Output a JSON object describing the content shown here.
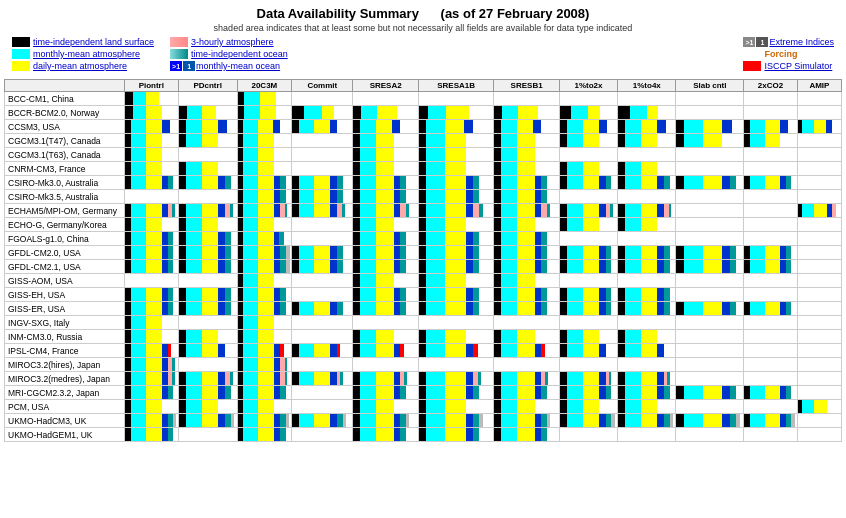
{
  "title": "Data Availability Summary",
  "as_of": "(as of 27 February 2008)",
  "subtitle": "shaded area indicates that at least some but not necessarily all fields are available for data type indicated",
  "legend": {
    "col1": [
      {
        "swatch": "black",
        "label": "time-independent land surface",
        "link": true
      },
      {
        "swatch": "cyan",
        "label": "monthly-mean atmosphere",
        "link": true
      },
      {
        "swatch": "yellow",
        "label": "daily-mean atmosphere",
        "link": true
      }
    ],
    "col2": [
      {
        "swatch": "pink-gradient",
        "label": "3-hourly atmosphere",
        "link": true
      },
      {
        "swatch": "teal-gradient",
        "label": "time-independent ocean",
        "link": true
      },
      {
        "swatch": "blue-badge",
        "label": "monthly-mean ocean",
        "link": true
      }
    ],
    "col3": [
      {
        "swatch": "gray-badge",
        "label": "Extreme Indices",
        "link": true
      },
      {
        "swatch": "orange-text",
        "label": "Forcing",
        "link": true
      },
      {
        "swatch": "red",
        "label": "ISCCP Simulator",
        "link": true
      }
    ]
  },
  "columns": [
    "Piontrl",
    "PDcntrl",
    "20C3M",
    "Commit",
    "SRESA2",
    "SRESA1B",
    "SRESB1",
    "1%to2x",
    "1%to4x",
    "Slab cntl",
    "2xCO2",
    "AMIP"
  ],
  "models": [
    "BCC-CM1, China",
    "BCCR-BCM2.0, Norway",
    "CCSM3, USA",
    "CGCM3.1(T47), Canada",
    "CGCM3.1(T63), Canada",
    "CNRM-CM3, France",
    "CSIRO-Mk3.0, Australia",
    "CSIRO-Mk3.5, Australia",
    "ECHAM5/MPI-OM, Germany",
    "ECHO-G, Germany/Korea",
    "FGOALS-g1.0, China",
    "GFDL-CM2.0, USA",
    "GFDL-CM2.1, USA",
    "GISS-AOM, USA",
    "GISS-EH, USA",
    "GISS-ER, USA",
    "INGV-SXG, Italy",
    "INM-CM3.0, Russia",
    "IPSL-CM4, France",
    "MIROC3.2(hires), Japan",
    "MIROC3.2(medres), Japan",
    "MRI-CGCM2.3.2, Japan",
    "PCM, USA",
    "UKMO-HadCM3, UK",
    "UKMO-HadGEM1, UK"
  ]
}
